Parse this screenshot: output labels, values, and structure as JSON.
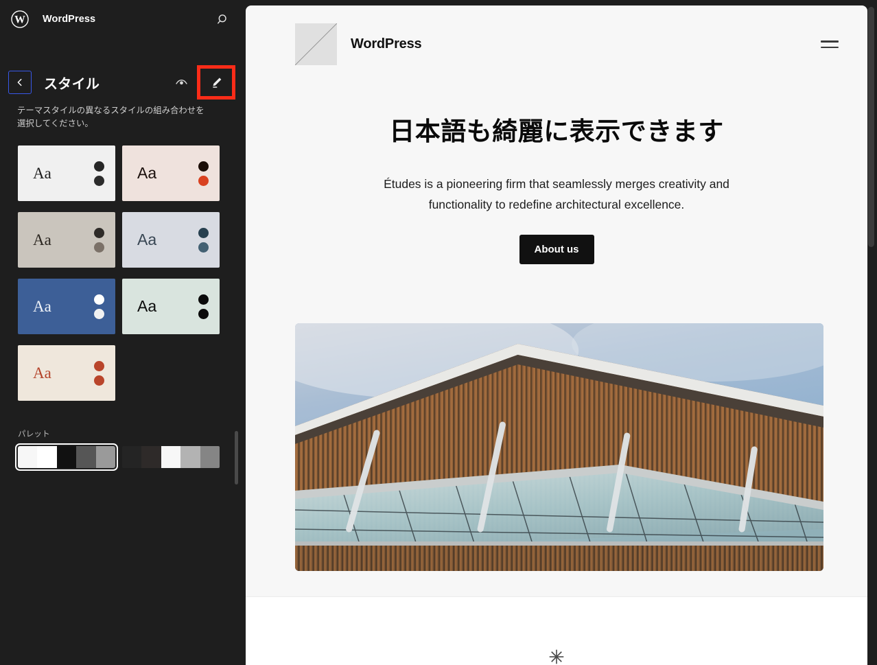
{
  "app": {
    "brand": "WordPress",
    "search_icon": "search-icon",
    "logo_icon": "wordpress-logo-icon"
  },
  "panel": {
    "back_icon": "chevron-left-icon",
    "title": "スタイル",
    "description": "テーマスタイルの異なるスタイルの組み合わせを選択してください。",
    "actions": [
      {
        "name": "style-book-button",
        "icon": "eye-icon"
      },
      {
        "name": "edit-styles-button",
        "icon": "pencil-icon",
        "highlighted": true
      }
    ],
    "highlight_color": "#fb2c18"
  },
  "variations": {
    "label_text": "Aa",
    "items": [
      {
        "name": "style-variation-default",
        "bg": "#f0f0f0",
        "text": "#1c1c1c",
        "font": "serif",
        "dot1": "#262626",
        "dot2": "#2b2b2b",
        "selected": false
      },
      {
        "name": "style-variation-rose",
        "bg": "#efe2dd",
        "text": "#1a0f0c",
        "font": "sans",
        "dot1": "#1c0e08",
        "dot2": "#d94120",
        "selected": false
      },
      {
        "name": "style-variation-sand",
        "bg": "#cac5bd",
        "text": "#2b2620",
        "font": "serif",
        "dot1": "#2e2b28",
        "dot2": "#7b7168",
        "selected": false
      },
      {
        "name": "style-variation-ice",
        "bg": "#d8dbe2",
        "text": "#384653",
        "font": "sans",
        "dot1": "#27404f",
        "dot2": "#436173",
        "selected": false
      },
      {
        "name": "style-variation-blue",
        "bg": "#3d5f97",
        "text": "#eef2f8",
        "font": "serif",
        "dot1": "#ffffff",
        "dot2": "#f1f1f1",
        "selected": false
      },
      {
        "name": "style-variation-mint",
        "bg": "#d9e4de",
        "text": "#0b0b0b",
        "font": "sans",
        "dot1": "#0a0a0a",
        "dot2": "#0a0a0a",
        "selected": false
      },
      {
        "name": "style-variation-clay",
        "bg": "#efe7dc",
        "text": "#b4432a",
        "font": "serif",
        "dot1": "#b9452b",
        "dot2": "#b9452b",
        "selected": false
      }
    ]
  },
  "palette": {
    "label": "パレット",
    "swatches": [
      {
        "name": "palette-swatch-mono-light",
        "selected": true,
        "colors": [
          "#f7f7f7",
          "#ffffff",
          "#111111",
          "#565656",
          "#9a9a9a"
        ]
      },
      {
        "name": "palette-swatch-mono-dark",
        "selected": false,
        "colors": [
          "#242424",
          "#2e2a29",
          "#f7f7f7",
          "#b3b3b3",
          "#858585"
        ]
      }
    ]
  },
  "preview": {
    "logo_icon": "site-logo-placeholder-icon",
    "site_title": "WordPress",
    "menu_icon": "hamburger-menu-icon",
    "heading": "日本語も綺麗に表示できます",
    "lead": "Études is a pioneering firm that seamlessly merges creativity and functionality to redefine architectural excellence.",
    "button_label": "About us",
    "image_alt": "architectural-building-photo",
    "divider_icon": "asterisk-icon"
  }
}
